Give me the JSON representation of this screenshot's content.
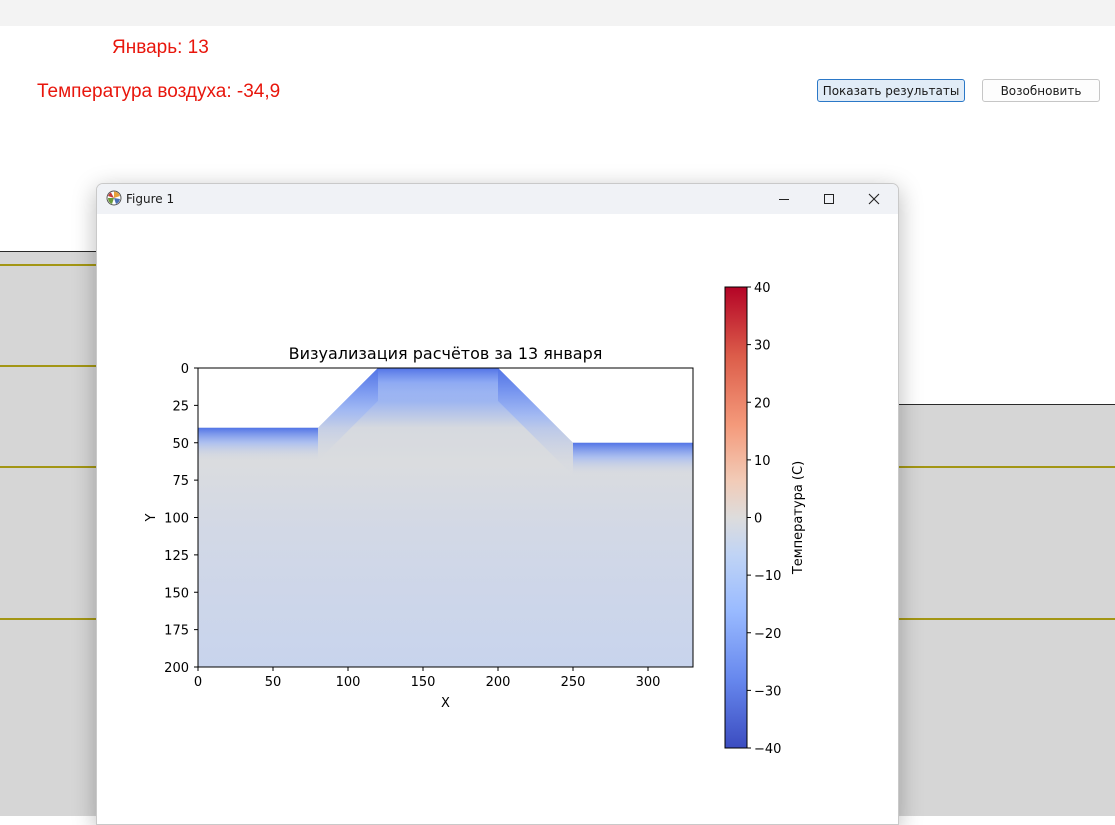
{
  "header": {
    "date_label": "Январь: 13",
    "air_temperature_label": "Температура воздуха: -34,9",
    "show_results_button": "Показать результаты",
    "resume_button": "Возобновить"
  },
  "figure_window": {
    "title": "Figure 1",
    "icons": [
      "matplotlib-app-icon",
      "minimize-icon",
      "maximize-icon",
      "close-icon"
    ]
  },
  "colors": {
    "info_text": "#e8160c",
    "primary_button_border": "#2b78c7",
    "background_lines": "#a39614"
  },
  "chart_data": {
    "type": "heatmap",
    "title": "Визуализация расчётов за 13 января",
    "xlabel": "X",
    "ylabel": "Y",
    "xlim": [
      0,
      330
    ],
    "ylim": [
      200,
      0
    ],
    "x_ticks": [
      0,
      50,
      100,
      150,
      200,
      250,
      300
    ],
    "y_ticks": [
      0,
      25,
      50,
      75,
      100,
      125,
      150,
      175,
      200
    ],
    "colormap": "coolwarm",
    "colorbar": {
      "label": "Температура (С)",
      "range": [
        -40,
        40
      ],
      "ticks": [
        "40",
        "30",
        "20",
        "10",
        "0",
        "−10",
        "−20",
        "−30",
        "−40"
      ]
    },
    "surface_profile": [
      {
        "x": 0,
        "y": 40
      },
      {
        "x": 80,
        "y": 40
      },
      {
        "x": 120,
        "y": 0
      },
      {
        "x": 200,
        "y": 0
      },
      {
        "x": 250,
        "y": 50
      },
      {
        "x": 330,
        "y": 50
      }
    ],
    "temperature_field": {
      "surface": -34.9,
      "near_surface_cold_layer": -25,
      "transition_depth_0C": 60,
      "deep": -6
    }
  }
}
